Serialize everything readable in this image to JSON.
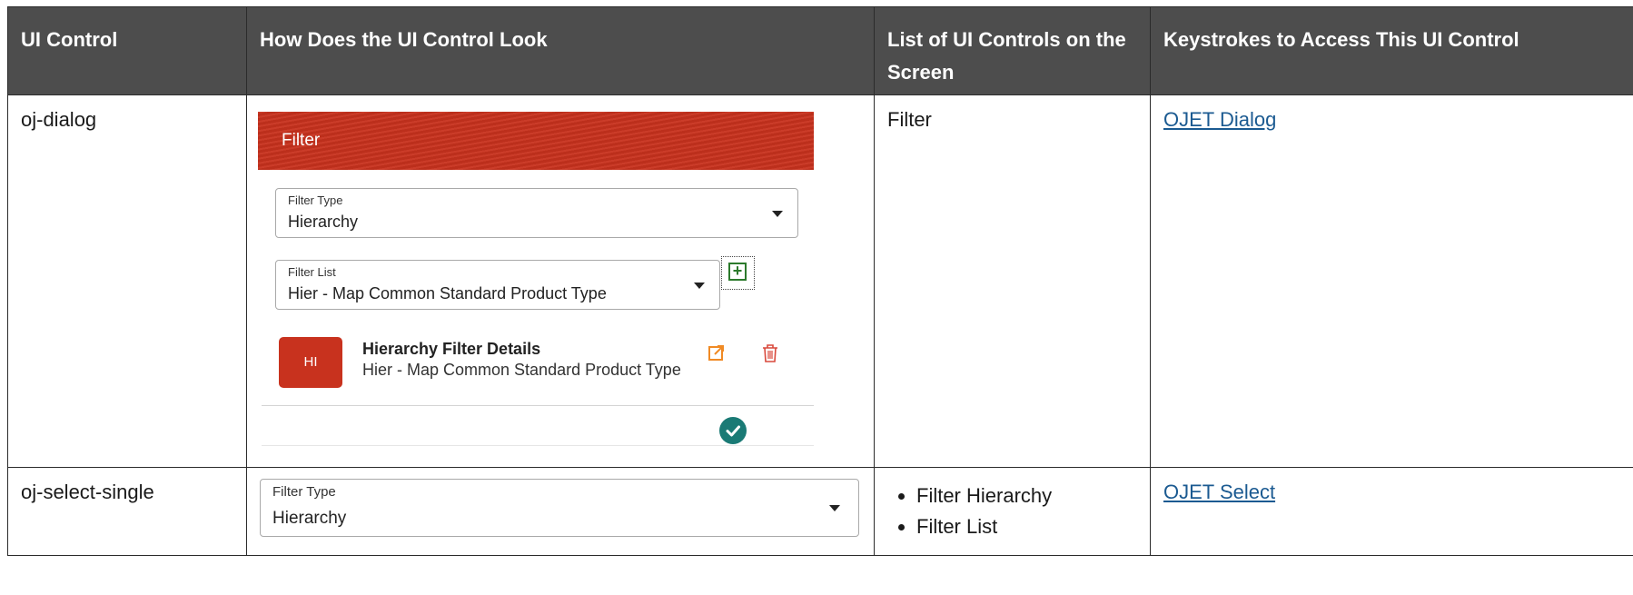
{
  "table": {
    "headers": [
      "UI Control",
      "How Does the UI Control Look",
      "List of UI Controls on the Screen",
      "Keystrokes to Access This UI Control"
    ],
    "rows": [
      {
        "control": "oj-dialog",
        "controls_list": [
          "Filter"
        ],
        "keystroke_link": "OJET Dialog",
        "preview": {
          "dialog_title": "Filter",
          "filter_type_label": "Filter Type",
          "filter_type_value": "Hierarchy",
          "filter_list_label": "Filter List",
          "filter_list_value": "Hier - Map Common Standard Product Type",
          "badge": "HI",
          "detail_title": "Hierarchy Filter Details",
          "detail_subtitle": "Hier - Map Common Standard Product Type"
        }
      },
      {
        "control": "oj-select-single",
        "controls_list": [
          "Filter Hierarchy",
          "Filter List"
        ],
        "keystroke_link": "OJET Select",
        "preview": {
          "label": "Filter Type",
          "value": "Hierarchy"
        }
      }
    ]
  },
  "colors": {
    "header_bg": "#4d4d4d",
    "dialog_header": "#c8321e",
    "link": "#1b5a91",
    "confirm": "#1a7a75",
    "edit_icon": "#f08a24",
    "delete_icon": "#d9483b",
    "add_icon": "#2c7a2c"
  },
  "icons": [
    "chevron-down-icon",
    "add-icon",
    "edit-external-icon",
    "trash-icon",
    "checkmark-icon"
  ]
}
